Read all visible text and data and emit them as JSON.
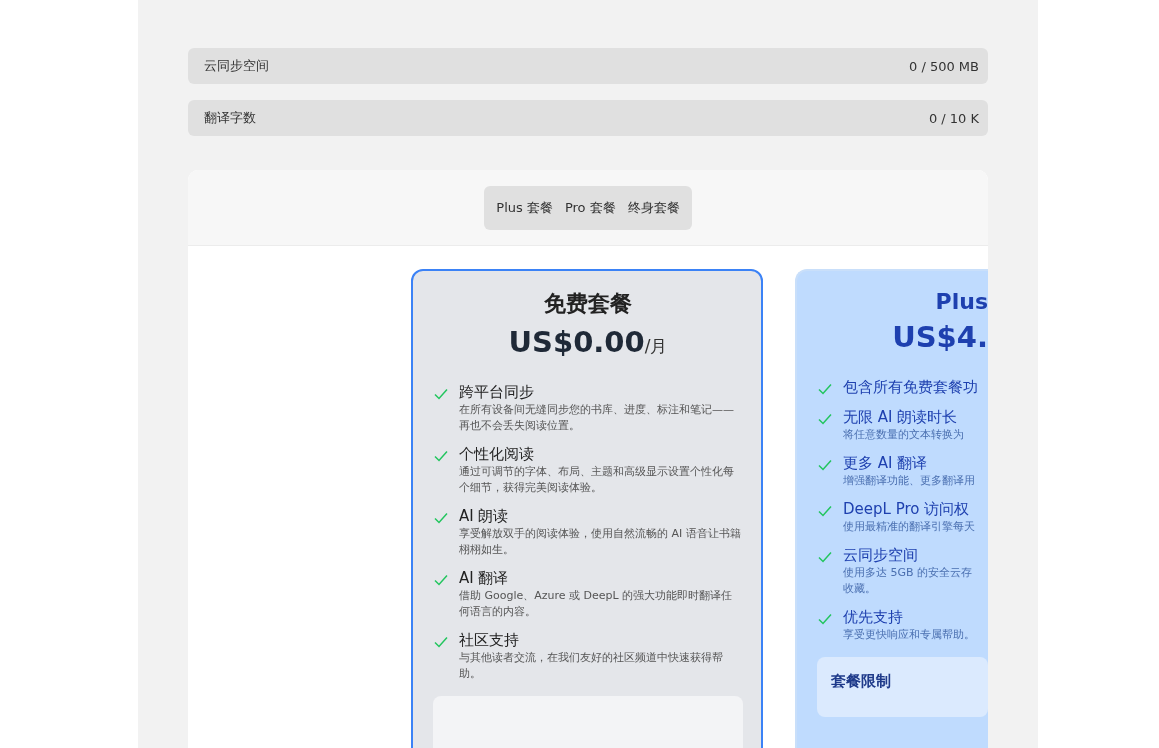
{
  "usage": [
    {
      "label": "云同步空间",
      "value": "0 / 500 MB"
    },
    {
      "label": "翻译字数",
      "value": "0 / 10 K"
    }
  ],
  "tabs": [
    {
      "label": "Plus 套餐",
      "selected": false
    },
    {
      "label": "Pro 套餐",
      "selected": false
    },
    {
      "label": "终身套餐",
      "selected": false
    }
  ],
  "plans": [
    {
      "title": "免费套餐",
      "price": "US$0.00",
      "period": "/月",
      "selected": true,
      "highlighted": false,
      "features": [
        {
          "title": "跨平台同步",
          "desc": "在所有设备间无缝同步您的书库、进度、标注和笔记——再也不会丢失阅读位置。"
        },
        {
          "title": "个性化阅读",
          "desc": "通过可调节的字体、布局、主题和高级显示设置个性化每个细节，获得完美阅读体验。"
        },
        {
          "title": "AI 朗读",
          "desc": "享受解放双手的阅读体验，使用自然流畅的 AI 语音让书籍栩栩如生。"
        },
        {
          "title": "AI 翻译",
          "desc": "借助 Google、Azure 或 DeepL 的强大功能即时翻译任何语言的内容。"
        },
        {
          "title": "社区支持",
          "desc": "与其他读者交流，在我们友好的社区频道中快速获得帮助。"
        }
      ]
    },
    {
      "title": "Plus",
      "price": "US$4.",
      "selected": false,
      "highlighted": true,
      "features": [
        {
          "title": "包含所有免费套餐功"
        },
        {
          "title": "无限 AI 朗读时长",
          "desc": "将任意数量的文本转换为"
        },
        {
          "title": "更多 AI 翻译",
          "desc": "增强翻译功能、更多翻译用"
        },
        {
          "title": "DeepL Pro 访问权",
          "desc": "使用最精准的翻译引擎每天"
        },
        {
          "title": "云同步空间",
          "desc": "使用多达 5GB 的安全云存",
          "desc_2": "收藏。"
        },
        {
          "title": "优先支持",
          "desc": "享受更快响应和专属帮助。"
        }
      ],
      "limits_title": "套餐限制"
    }
  ]
}
